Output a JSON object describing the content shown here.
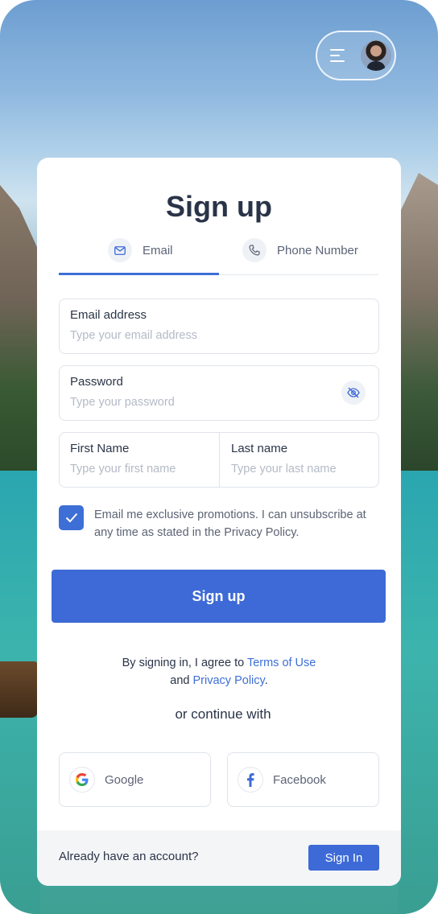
{
  "colors": {
    "accent": "#3d6ad6",
    "text": "#2a3448",
    "muted": "#5b6375",
    "placeholder": "#b4bac6"
  },
  "header": {
    "menu_icon": "hamburger-icon",
    "avatar": "user-avatar"
  },
  "title": "Sign up",
  "tabs": [
    {
      "label": "Email",
      "icon": "mail-icon",
      "active": true
    },
    {
      "label": "Phone Number",
      "icon": "phone-icon",
      "active": false
    }
  ],
  "fields": {
    "email": {
      "label": "Email address",
      "placeholder": "Type your email address",
      "value": ""
    },
    "password": {
      "label": "Password",
      "placeholder": "Type your password",
      "value": "",
      "toggle_icon": "eye-off-icon"
    },
    "first_name": {
      "label": "First Name",
      "placeholder": "Type your first name",
      "value": ""
    },
    "last_name": {
      "label": "Last name",
      "placeholder": "Type your last name",
      "value": ""
    }
  },
  "consent": {
    "checked": true,
    "text": "Email me exclusive  promotions. I can unsubscribe at any time as stated in the Privacy Policy."
  },
  "signup_button": "Sign up",
  "terms": {
    "prefix": "By signing in, I agree to ",
    "terms_link": "Terms of Use",
    "and": "and ",
    "privacy_link": "Privacy Policy",
    "suffix": "."
  },
  "continue_with": "or continue with",
  "social": {
    "google": {
      "label": "Google",
      "icon": "google-icon"
    },
    "facebook": {
      "label": "Facebook",
      "icon": "facebook-icon"
    }
  },
  "footer": {
    "prompt": "Already have an account?",
    "signin_button": "Sign In"
  }
}
